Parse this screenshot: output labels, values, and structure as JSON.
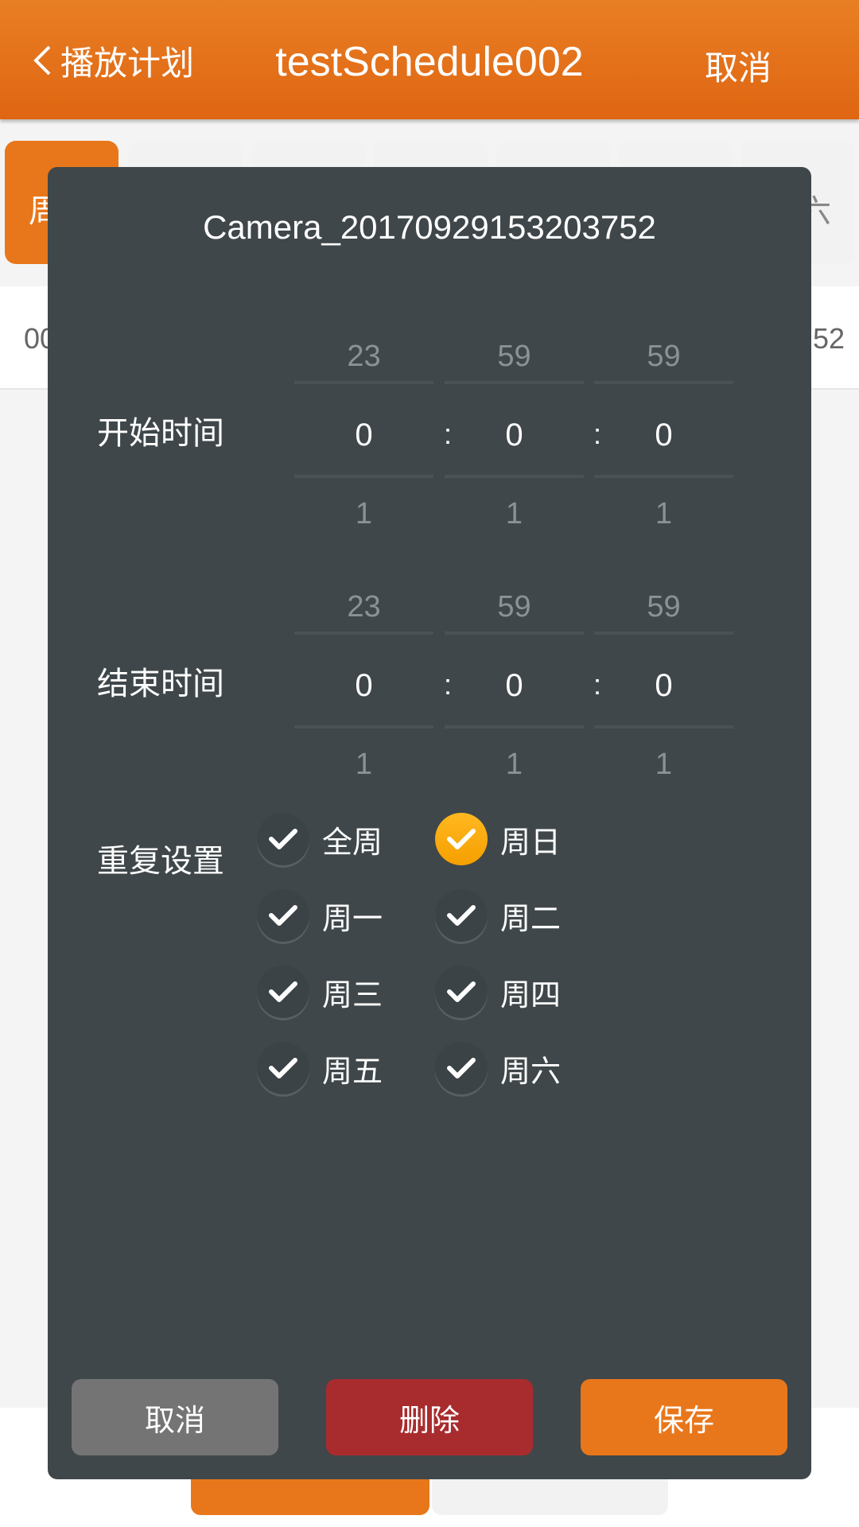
{
  "header": {
    "back_label": "播放计划",
    "title": "testSchedule002",
    "cancel_label": "取消"
  },
  "day_tabs": [
    {
      "label": "周",
      "active": true
    },
    {
      "label": ""
    },
    {
      "label": ""
    },
    {
      "label": ""
    },
    {
      "label": ""
    },
    {
      "label": ""
    },
    {
      "label": "六"
    }
  ],
  "schedule_row": {
    "start_fragment": "00",
    "end_fragment": "52"
  },
  "dialog": {
    "title": "Camera_20170929153203752",
    "start": {
      "label": "开始时间",
      "hour": {
        "prev": "23",
        "value": "0",
        "next": "1"
      },
      "minute": {
        "prev": "59",
        "value": "0",
        "next": "1"
      },
      "second": {
        "prev": "59",
        "value": "0",
        "next": "1"
      }
    },
    "end": {
      "label": "结束时间",
      "hour": {
        "prev": "23",
        "value": "0",
        "next": "1"
      },
      "minute": {
        "prev": "59",
        "value": "0",
        "next": "1"
      },
      "second": {
        "prev": "59",
        "value": "0",
        "next": "1"
      }
    },
    "separator": ":",
    "repeat": {
      "label": "重复设置",
      "options": [
        {
          "label": "全周",
          "checked": false
        },
        {
          "label": "周日",
          "checked": true
        },
        {
          "label": "周一",
          "checked": false
        },
        {
          "label": "周二",
          "checked": false
        },
        {
          "label": "周三",
          "checked": false
        },
        {
          "label": "周四",
          "checked": false
        },
        {
          "label": "周五",
          "checked": false
        },
        {
          "label": "周六",
          "checked": false
        }
      ]
    },
    "buttons": {
      "cancel": "取消",
      "delete": "删除",
      "save": "保存"
    }
  },
  "colors": {
    "accent": "#e8771b",
    "delete": "#a82c2e",
    "cancel": "#747474",
    "dialog_bg": "#3f474a",
    "checked": "#ffb000"
  }
}
